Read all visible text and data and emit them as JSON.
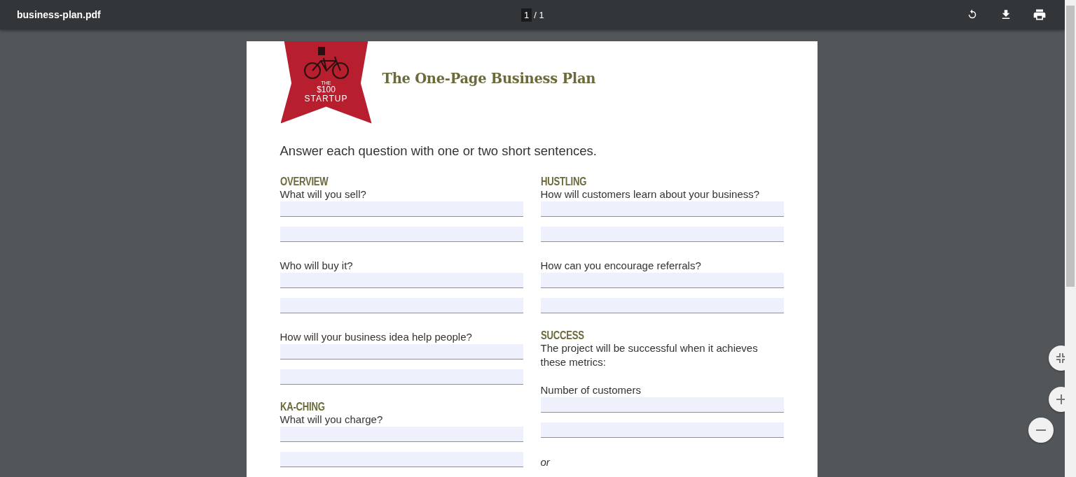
{
  "toolbar": {
    "file_name": "business-plan.pdf",
    "current_page": "1",
    "page_total": "/ 1"
  },
  "document": {
    "logo": {
      "line_1": "THE",
      "line_2": "$100",
      "line_3": "STARTUP"
    },
    "title": "The One-Page Business Plan",
    "instruction": "Answer each question with one or two short sentences.",
    "columns": [
      [
        {
          "kind": "heading",
          "text": "OVERVIEW"
        },
        {
          "kind": "question",
          "text": "What will you sell?"
        },
        {
          "kind": "field"
        },
        {
          "kind": "field"
        },
        {
          "kind": "question",
          "text": "Who will buy it?"
        },
        {
          "kind": "field"
        },
        {
          "kind": "field"
        },
        {
          "kind": "question",
          "text": "How will your business idea help people?"
        },
        {
          "kind": "field"
        },
        {
          "kind": "field"
        },
        {
          "kind": "heading",
          "text": "KA-CHING"
        },
        {
          "kind": "question",
          "text": "What will you charge?"
        },
        {
          "kind": "field"
        },
        {
          "kind": "field"
        }
      ],
      [
        {
          "kind": "heading",
          "text": "HUSTLING"
        },
        {
          "kind": "question",
          "text": "How will customers learn about your business?"
        },
        {
          "kind": "field"
        },
        {
          "kind": "field"
        },
        {
          "kind": "question",
          "text": "How can you encourage referrals?"
        },
        {
          "kind": "field"
        },
        {
          "kind": "field"
        },
        {
          "kind": "heading",
          "text": "SUCCESS"
        },
        {
          "kind": "question",
          "text": "The project will be successful when it achieves these metrics:"
        },
        {
          "kind": "question",
          "text": "Number of customers"
        },
        {
          "kind": "field"
        },
        {
          "kind": "field"
        },
        {
          "kind": "note",
          "text": "or"
        }
      ]
    ]
  }
}
